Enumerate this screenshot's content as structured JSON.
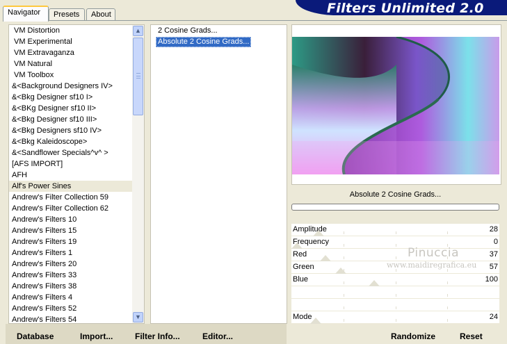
{
  "app": {
    "title": "Filters Unlimited 2.0",
    "tabs": [
      {
        "label": "Navigator",
        "active": true
      },
      {
        "label": "Presets",
        "active": false
      },
      {
        "label": "About",
        "active": false
      }
    ]
  },
  "categories": {
    "items": [
      {
        "label": "VM Distortion"
      },
      {
        "label": "VM Experimental"
      },
      {
        "label": "VM Extravaganza"
      },
      {
        "label": "VM Natural"
      },
      {
        "label": "VM Toolbox"
      },
      {
        "label": "&<Background Designers IV>"
      },
      {
        "label": "&<Bkg Designer sf10 I>"
      },
      {
        "label": "&<BKg Designer sf10 II>"
      },
      {
        "label": "&<Bkg Designer sf10 III>"
      },
      {
        "label": "&<Bkg Designers sf10 IV>"
      },
      {
        "label": "&<Bkg Kaleidoscope>"
      },
      {
        "label": "&<Sandflower Specials^v^ >"
      },
      {
        "label": "[AFS IMPORT]"
      },
      {
        "label": "AFH"
      },
      {
        "label": "Alf's Power Sines",
        "selected": true
      },
      {
        "label": "Andrew's Filter Collection 59"
      },
      {
        "label": "Andrew's Filter Collection 62"
      },
      {
        "label": "Andrew's Filters 10"
      },
      {
        "label": "Andrew's Filters 15"
      },
      {
        "label": "Andrew's Filters 19"
      },
      {
        "label": "Andrew's Filters 1"
      },
      {
        "label": "Andrew's Filters 20"
      },
      {
        "label": "Andrew's Filters 33"
      },
      {
        "label": "Andrew's Filters 38"
      },
      {
        "label": "Andrew's Filters 4"
      },
      {
        "label": "Andrew's Filters 52"
      },
      {
        "label": "Andrew's Filters 54"
      }
    ],
    "scroll_up_icon": "chevron-up-icon",
    "scroll_down_icon": "chevron-down-icon"
  },
  "filters": {
    "items": [
      {
        "label": "2 Cosine Grads...",
        "selected": false
      },
      {
        "label": "Absolute 2 Cosine Grads...",
        "selected": true
      }
    ]
  },
  "preview": {
    "filter_name": "Absolute 2 Cosine Grads...",
    "progress": 0
  },
  "parameters": [
    {
      "label": "Amplitude",
      "value": "28",
      "level": 28
    },
    {
      "label": "Frequency",
      "value": "0",
      "level": 0
    },
    {
      "label": "Red",
      "value": "37",
      "level": 37
    },
    {
      "label": "Green",
      "value": "57",
      "level": 57
    },
    {
      "label": "Blue",
      "value": "100",
      "level": 100
    },
    {
      "label": "",
      "value": "",
      "level": null
    },
    {
      "label": "",
      "value": "",
      "level": null
    },
    {
      "label": "Mode",
      "value": "24",
      "level": 24
    }
  ],
  "watermark": {
    "title": "Pinuccia",
    "url": "www.maidiregrafica.eu"
  },
  "buttons": {
    "database": "Database",
    "import": "Import...",
    "filter_info": "Filter Info...",
    "editor": "Editor...",
    "randomize": "Randomize",
    "reset": "Reset"
  },
  "colors": {
    "selection": "#316ac5",
    "banner": "#0a1a7a",
    "window": "#ece9d8"
  }
}
